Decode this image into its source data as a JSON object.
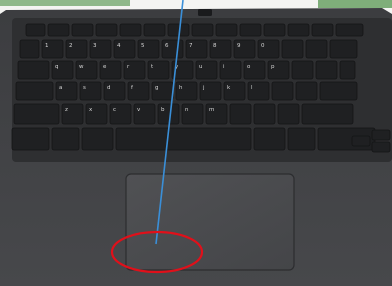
{
  "photo": {
    "subject": "laptop-keyboard-and-touchpad",
    "colors": {
      "body": "#3a3b3d",
      "deck": "#444548",
      "key": "#1f2022",
      "key_edge": "#141516",
      "touchpad": "#4a4b4e",
      "annotation_line": "#3a8fd8",
      "annotation_circle": "#e0101a"
    }
  },
  "keyboard": {
    "rows": {
      "row_1": [
        "",
        "",
        "",
        "",
        "",
        "",
        "",
        "",
        "",
        "",
        "",
        "",
        "",
        ""
      ],
      "row_2": [
        "",
        "1",
        "2",
        "3",
        "4",
        "5",
        "6",
        "7",
        "8",
        "9",
        "0",
        "",
        "",
        ""
      ],
      "row_3": [
        "",
        "q",
        "w",
        "e",
        "r",
        "t",
        "y",
        "u",
        "i",
        "o",
        "p",
        "",
        "",
        ""
      ],
      "row_4": [
        "",
        "a",
        "s",
        "d",
        "f",
        "g",
        "h",
        "j",
        "k",
        "l",
        "",
        "",
        ""
      ],
      "row_5": [
        "",
        "z",
        "x",
        "c",
        "v",
        "b",
        "n",
        "m",
        "",
        "",
        "",
        ""
      ],
      "row_6": [
        "",
        "",
        "",
        "",
        "",
        "",
        ""
      ]
    }
  }
}
